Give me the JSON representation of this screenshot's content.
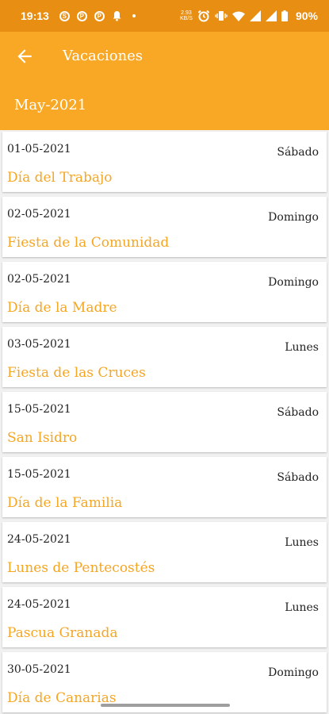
{
  "status_bar": {
    "time": "19:13",
    "speed_top": "2.93",
    "speed_bottom": "KB/S",
    "battery": "90%"
  },
  "app_bar": {
    "title": "Vacaciones",
    "month": "May-2021"
  },
  "holidays": [
    {
      "date": "01-05-2021",
      "day": "Sábado",
      "name": "Día del Trabajo"
    },
    {
      "date": "02-05-2021",
      "day": "Domingo",
      "name": "Fiesta de la Comunidad"
    },
    {
      "date": "02-05-2021",
      "day": "Domingo",
      "name": "Día de la Madre"
    },
    {
      "date": "03-05-2021",
      "day": "Lunes",
      "name": "Fiesta de las Cruces"
    },
    {
      "date": "15-05-2021",
      "day": "Sábado",
      "name": "San Isidro"
    },
    {
      "date": "15-05-2021",
      "day": "Sábado",
      "name": "Día de la Familia"
    },
    {
      "date": "24-05-2021",
      "day": "Lunes",
      "name": "Lunes de Pentecostés"
    },
    {
      "date": "24-05-2021",
      "day": "Lunes",
      "name": "Pascua Granada"
    },
    {
      "date": "30-05-2021",
      "day": "Domingo",
      "name": "Día de Canarias"
    }
  ],
  "colors": {
    "status_bar": "#e88e12",
    "app_bar": "#f9a825",
    "holiday_name": "#f5a623"
  }
}
